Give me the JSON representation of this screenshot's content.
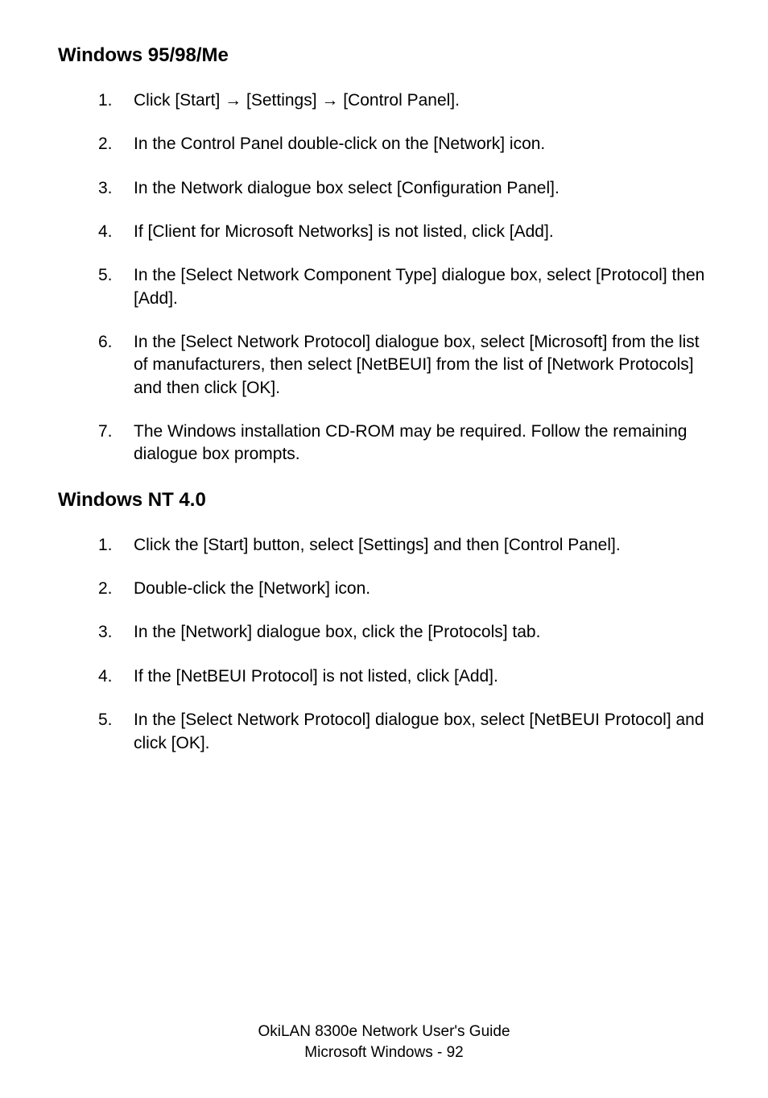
{
  "section1": {
    "heading": "Windows 95/98/Me",
    "items": [
      {
        "num": "1.",
        "text": "Click [Start] → [Settings] → [Control Panel]."
      },
      {
        "num": "2.",
        "text": "In the Control Panel double-click on the [Network] icon."
      },
      {
        "num": "3.",
        "text": "In the Network dialogue box select [Configuration Panel]."
      },
      {
        "num": "4.",
        "text": "If [Client for Microsoft Networks] is not listed, click  [Add]."
      },
      {
        "num": "5.",
        "text": "In the [Select Network Component Type] dialogue box, select [Protocol] then [Add]."
      },
      {
        "num": "6.",
        "text": "In the [Select Network Protocol] dialogue box, select [Microsoft] from the list of manufacturers, then select [NetBEUI] from the list of [Network Protocols] and then click [OK]."
      },
      {
        "num": "7.",
        "text": "The Windows installation CD-ROM may be required. Follow the remaining dialogue box prompts."
      }
    ]
  },
  "section2": {
    "heading": "Windows NT 4.0",
    "items": [
      {
        "num": "1.",
        "text": "Click the [Start] button, select [Settings] and then [Control Panel]."
      },
      {
        "num": "2.",
        "text": "Double-click the [Network] icon."
      },
      {
        "num": "3.",
        "text": "In the [Network] dialogue box, click the [Protocols] tab."
      },
      {
        "num": "4.",
        "text": "If the [NetBEUI Protocol] is not listed, click  [Add]."
      },
      {
        "num": "5.",
        "text": "In the [Select Network Protocol] dialogue box, select [NetBEUI Protocol] and click [OK]."
      }
    ]
  },
  "footer": {
    "line1": "OkiLAN 8300e Network User's Guide",
    "line2": "Microsoft Windows   -   92"
  }
}
